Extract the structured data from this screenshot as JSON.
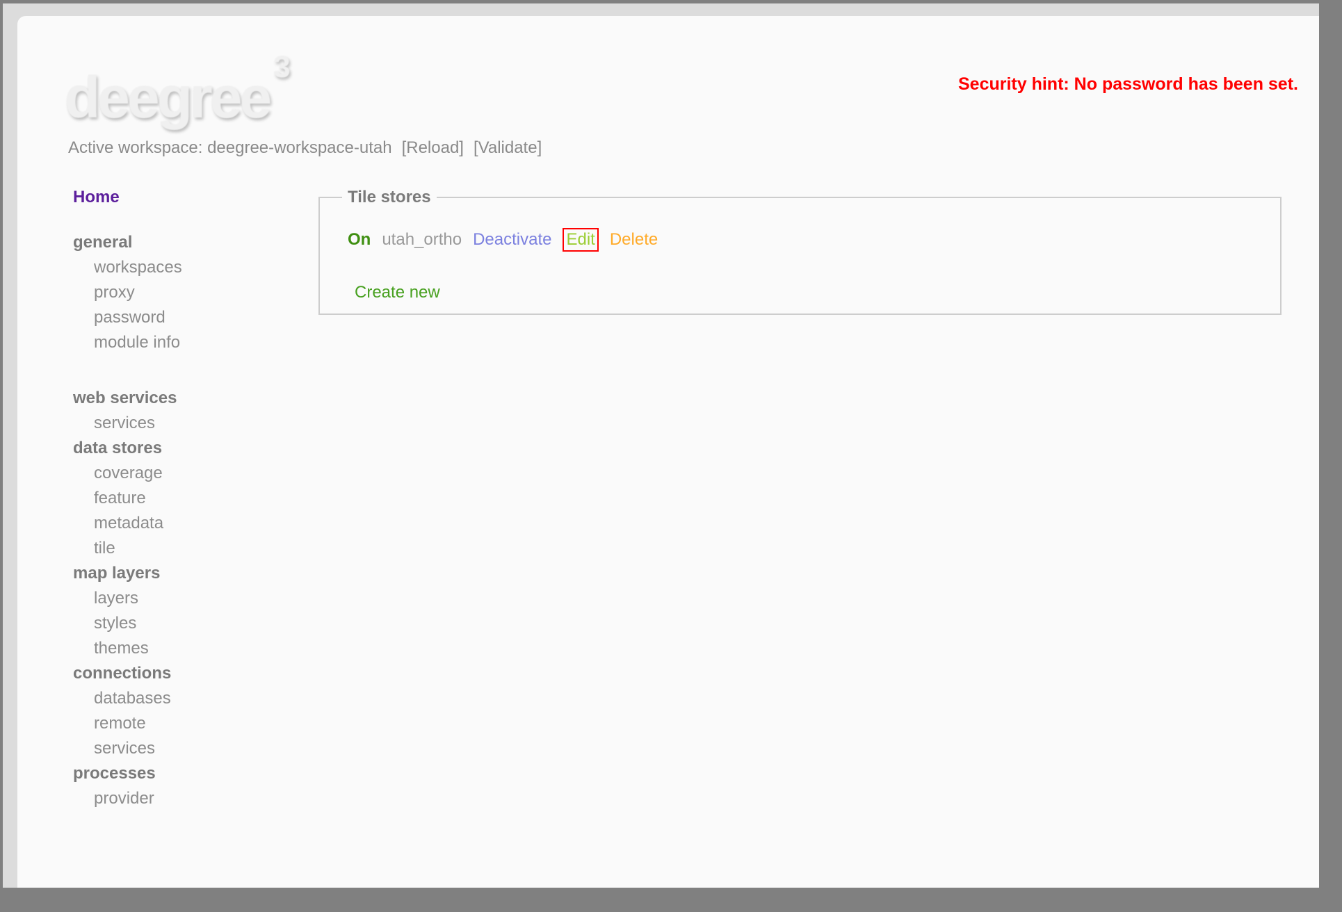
{
  "window": {
    "frame_color": "#808080",
    "page_bg": "#dcdcdc",
    "card_bg": "#fafafa"
  },
  "header": {
    "logo_text": "deegree",
    "logo_sup": "3",
    "security_hint": "Security hint: No password has been set.",
    "workspace_line": {
      "text": "Active workspace: deegree-workspace-utah",
      "reload_link": "[Reload]",
      "validate_link": "[Validate]"
    }
  },
  "sidebar": {
    "home_label": "Home",
    "groups": [
      {
        "header": "general",
        "items": [
          "workspaces",
          "proxy",
          "password",
          "module info"
        ]
      },
      {
        "header": "web services",
        "items": [
          "services"
        ]
      },
      {
        "header": "data stores",
        "items": [
          "coverage",
          "feature",
          "metadata",
          "tile"
        ]
      },
      {
        "header": "map layers",
        "items": [
          "layers",
          "styles",
          "themes"
        ]
      },
      {
        "header": "connections",
        "items": [
          "databases",
          "remote",
          "services"
        ]
      },
      {
        "header": "processes",
        "items": [
          "provider"
        ]
      }
    ]
  },
  "tile_stores": {
    "legend": "Tile stores",
    "store": {
      "status": "On",
      "name": "utah_ortho",
      "deactivate_label": "Deactivate",
      "edit_label": "Edit",
      "delete_label": "Delete"
    },
    "create_new_label": "Create new"
  },
  "colors": {
    "status_on_green": "#3f8f11",
    "deactivate_blue": "#7b80df",
    "edit_yellowgreen": "#9acd32",
    "edit_highlight_border_red": "#ff0000",
    "delete_orange": "#ffaa28",
    "create_new_green": "#47a01f",
    "security_hint_red": "#ff0000",
    "home_purple": "#5c1f9c",
    "body_text_gray": "#8a8a8a"
  }
}
